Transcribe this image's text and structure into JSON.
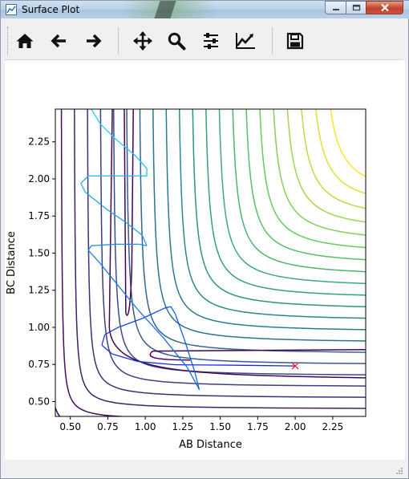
{
  "window": {
    "title": "Surface Plot"
  },
  "toolbar": {
    "buttons": [
      {
        "name": "home-button",
        "icon": "home-icon"
      },
      {
        "name": "back-button",
        "icon": "arrow-left-icon"
      },
      {
        "name": "forward-button",
        "icon": "arrow-right-icon"
      },
      {
        "name": "pan-button",
        "icon": "move-icon"
      },
      {
        "name": "zoom-button",
        "icon": "magnifier-icon"
      },
      {
        "name": "configure-subplots-button",
        "icon": "sliders-icon"
      },
      {
        "name": "edit-axes-button",
        "icon": "line-chart-icon"
      },
      {
        "name": "save-button",
        "icon": "floppy-disk-icon"
      }
    ]
  },
  "chart_data": {
    "type": "contour",
    "xlabel": "AB Distance",
    "ylabel": "BC Distance",
    "xlim": [
      0.4,
      2.47
    ],
    "ylim": [
      0.4,
      2.47
    ],
    "xticks": [
      "0.50",
      "0.75",
      "1.00",
      "1.25",
      "1.50",
      "1.75",
      "2.00",
      "2.25"
    ],
    "yticks": [
      "0.50",
      "0.75",
      "1.00",
      "1.25",
      "1.50",
      "1.75",
      "2.00",
      "2.25"
    ],
    "colormap": "viridis",
    "grid": false,
    "start_marker": {
      "x": 2.0,
      "y": 0.74,
      "symbol": "x",
      "color": "#e8202a"
    },
    "trajectory": [
      [
        2.0,
        0.74
      ],
      [
        1.6,
        0.745
      ],
      [
        1.2,
        0.748
      ],
      [
        0.95,
        0.77
      ],
      [
        0.78,
        0.82
      ],
      [
        0.71,
        0.88
      ],
      [
        0.73,
        0.95
      ],
      [
        0.82,
        1.0
      ],
      [
        0.98,
        1.06
      ],
      [
        1.13,
        1.13
      ],
      [
        1.17,
        1.14
      ],
      [
        1.2,
        1.09
      ],
      [
        1.26,
        0.92
      ],
      [
        1.33,
        0.7
      ],
      [
        1.36,
        0.58
      ],
      [
        1.35,
        0.6
      ],
      [
        1.28,
        0.73
      ],
      [
        1.12,
        0.93
      ],
      [
        0.95,
        1.12
      ],
      [
        0.82,
        1.28
      ],
      [
        0.7,
        1.43
      ],
      [
        0.62,
        1.52
      ],
      [
        0.64,
        1.55
      ],
      [
        0.8,
        1.56
      ],
      [
        0.96,
        1.56
      ],
      [
        1.01,
        1.55
      ],
      [
        0.98,
        1.62
      ],
      [
        0.88,
        1.7
      ],
      [
        0.75,
        1.79
      ],
      [
        0.6,
        1.91
      ],
      [
        0.57,
        1.97
      ],
      [
        0.62,
        2.02
      ],
      [
        0.8,
        2.02
      ],
      [
        0.95,
        2.02
      ],
      [
        1.01,
        2.02
      ],
      [
        1.01,
        2.07
      ],
      [
        0.93,
        2.16
      ],
      [
        0.8,
        2.27
      ],
      [
        0.7,
        2.37
      ],
      [
        0.64,
        2.47
      ]
    ]
  }
}
